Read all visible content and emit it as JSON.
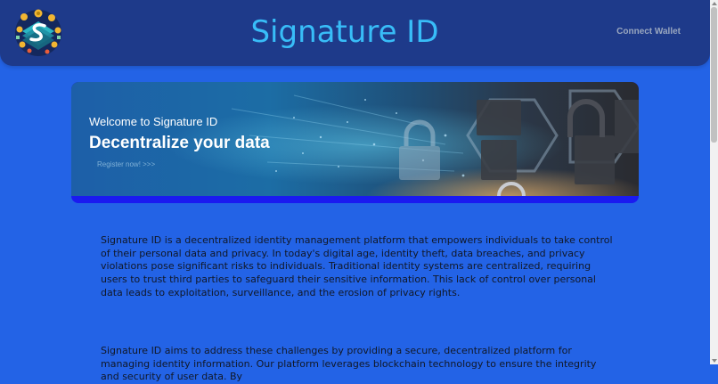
{
  "header": {
    "title": "Signature ID",
    "connect_label": "Connect Wallet",
    "logo_icon": "signature-id-logo"
  },
  "hero": {
    "welcome": "Welcome to Signature ID",
    "headline": "Decentralize your data",
    "register_link": "Register now! >>>",
    "image_icon": "cyber-security-padlock-banner"
  },
  "content": {
    "paragraph1": "Signature ID is a decentralized identity management platform that empowers individuals to take control of their personal data and privacy. In today's digital age, identity theft, data breaches, and privacy violations pose significant risks to individuals. Traditional identity systems are centralized, requiring users to trust third parties to safeguard their sensitive information. This lack of control over personal data leads to exploitation, surveillance, and the erosion of privacy rights.",
    "paragraph2": "Signature ID aims to address these challenges by providing a secure, decentralized platform for managing identity information. Our platform leverages blockchain technology to ensure the integrity and security of user data. By"
  },
  "colors": {
    "page_bg": "#2363e6",
    "header_bg": "#1e3a8a",
    "title": "#38bdf8",
    "hero_underline": "#1a1af0"
  }
}
